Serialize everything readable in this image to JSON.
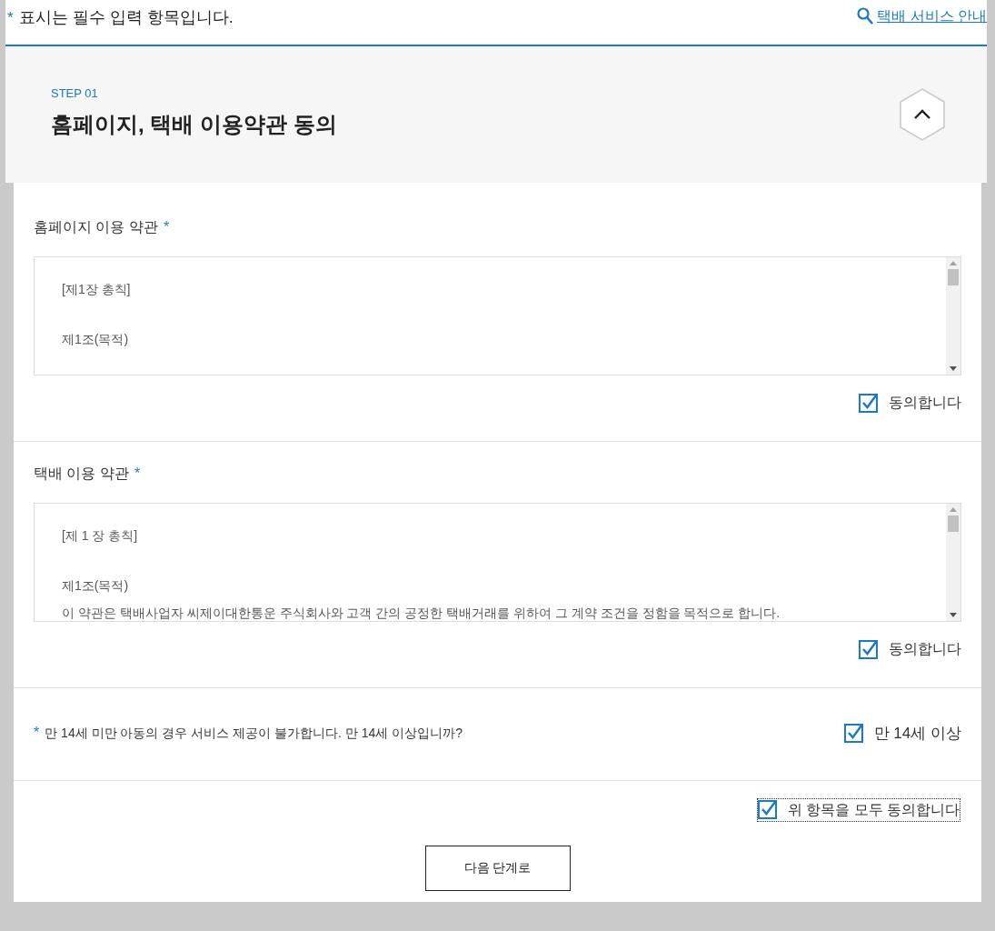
{
  "required_note": {
    "mark": "*",
    "text": "표시는 필수 입력 항목입니다."
  },
  "guide_link": "택배 서비스 안내",
  "step": {
    "label": "STEP 01",
    "title": "홈페이지, 택배 이용약관 동의",
    "expanded": true
  },
  "terms": [
    {
      "title": "홈페이지 이용 약관",
      "required_mark": "*",
      "paragraphs": [
        [
          "[제1장 총칙]"
        ],
        [
          "제1조(목적)"
        ]
      ],
      "agree": {
        "label": "동의합니다",
        "checked": true
      }
    },
    {
      "title": "택배 이용 약관",
      "required_mark": "*",
      "paragraphs": [
        [
          "[제 1 장 총칙]"
        ],
        [
          "제1조(목적)",
          "이 약관은 택배사업자 씨제이대한통운 주식회사와 고객 간의 공정한 택배거래를 위하여 그 계약 조건을 정함을 목적으로 합니다."
        ]
      ],
      "agree": {
        "label": "동의합니다",
        "checked": true
      }
    }
  ],
  "age_check": {
    "required_mark": "*",
    "question": "만 14세 미만 아동의 경우 서비스 제공이 불가합니다. 만 14세 이상입니까?",
    "label": "만 14세 이상",
    "checked": true
  },
  "agree_all": {
    "label": "위 항목을 모두 동의합니다",
    "checked": true,
    "focused": true
  },
  "next_button": "다음 단계로"
}
